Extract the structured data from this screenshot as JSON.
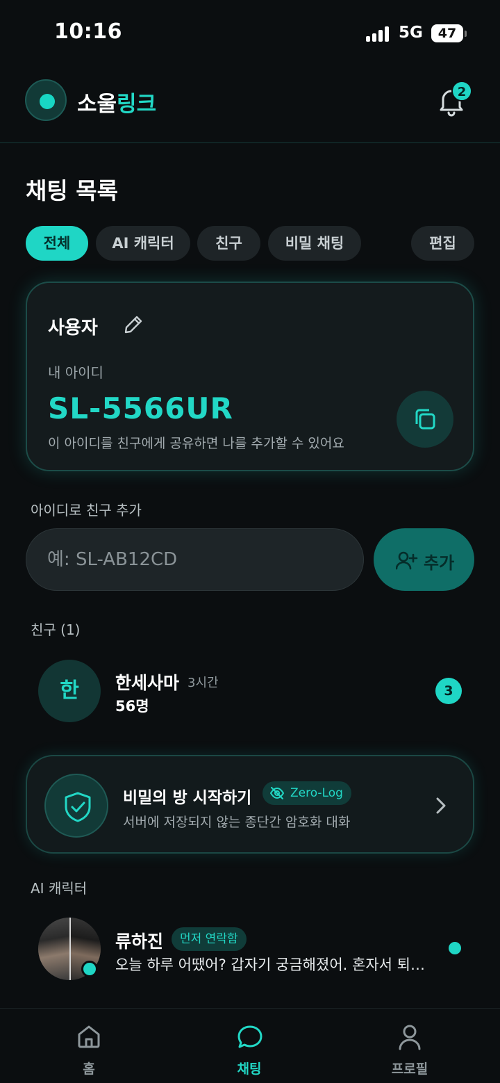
{
  "status_bar": {
    "time": "10:16",
    "network": "5G",
    "battery": "47"
  },
  "header": {
    "brand_part1": "소울",
    "brand_part2": "링크",
    "notification_count": "2"
  },
  "page_title": "채팅 목록",
  "filters": [
    {
      "label": "전체",
      "active": true
    },
    {
      "label": "AI 캐릭터",
      "active": false
    },
    {
      "label": "친구",
      "active": false
    },
    {
      "label": "비밀 채팅",
      "active": false
    }
  ],
  "edit_label": "편집",
  "user_card": {
    "name": "사용자",
    "id_label": "내 아이디",
    "id_value": "SL-5566UR",
    "hint": "이 아이디를 친구에게 공유하면 나를 추가할 수 있어요"
  },
  "add_friend": {
    "section_label": "아이디로 친구 추가",
    "placeholder": "예: SL-AB12CD",
    "button_label": "추가"
  },
  "friends": {
    "section_label": "친구 (1)",
    "items": [
      {
        "avatar_letter": "한",
        "name": "한세사마",
        "time": "3시간",
        "message": "56명",
        "unread": "3"
      }
    ]
  },
  "secret_room": {
    "title": "비밀의 방 시작하기",
    "badge": "Zero-Log",
    "subtitle": "서버에 저장되지 않는 종단간 암호화 대화"
  },
  "ai_characters": {
    "section_label": "AI 캐릭터",
    "items": [
      {
        "name": "류하진",
        "badge": "먼저 연락함",
        "message": "오늘 하루 어땠어? 갑자기 궁금해졌어. 혼자서 퇴근길에..."
      }
    ]
  },
  "bottom_nav": [
    {
      "label": "홈",
      "icon": "home-icon",
      "active": false
    },
    {
      "label": "채팅",
      "icon": "chat-bubble-icon",
      "active": true
    },
    {
      "label": "프로필",
      "icon": "person-icon",
      "active": false
    }
  ],
  "colors": {
    "accent": "#1fd6c5",
    "background": "#0b0e10",
    "card": "#141b1d"
  }
}
